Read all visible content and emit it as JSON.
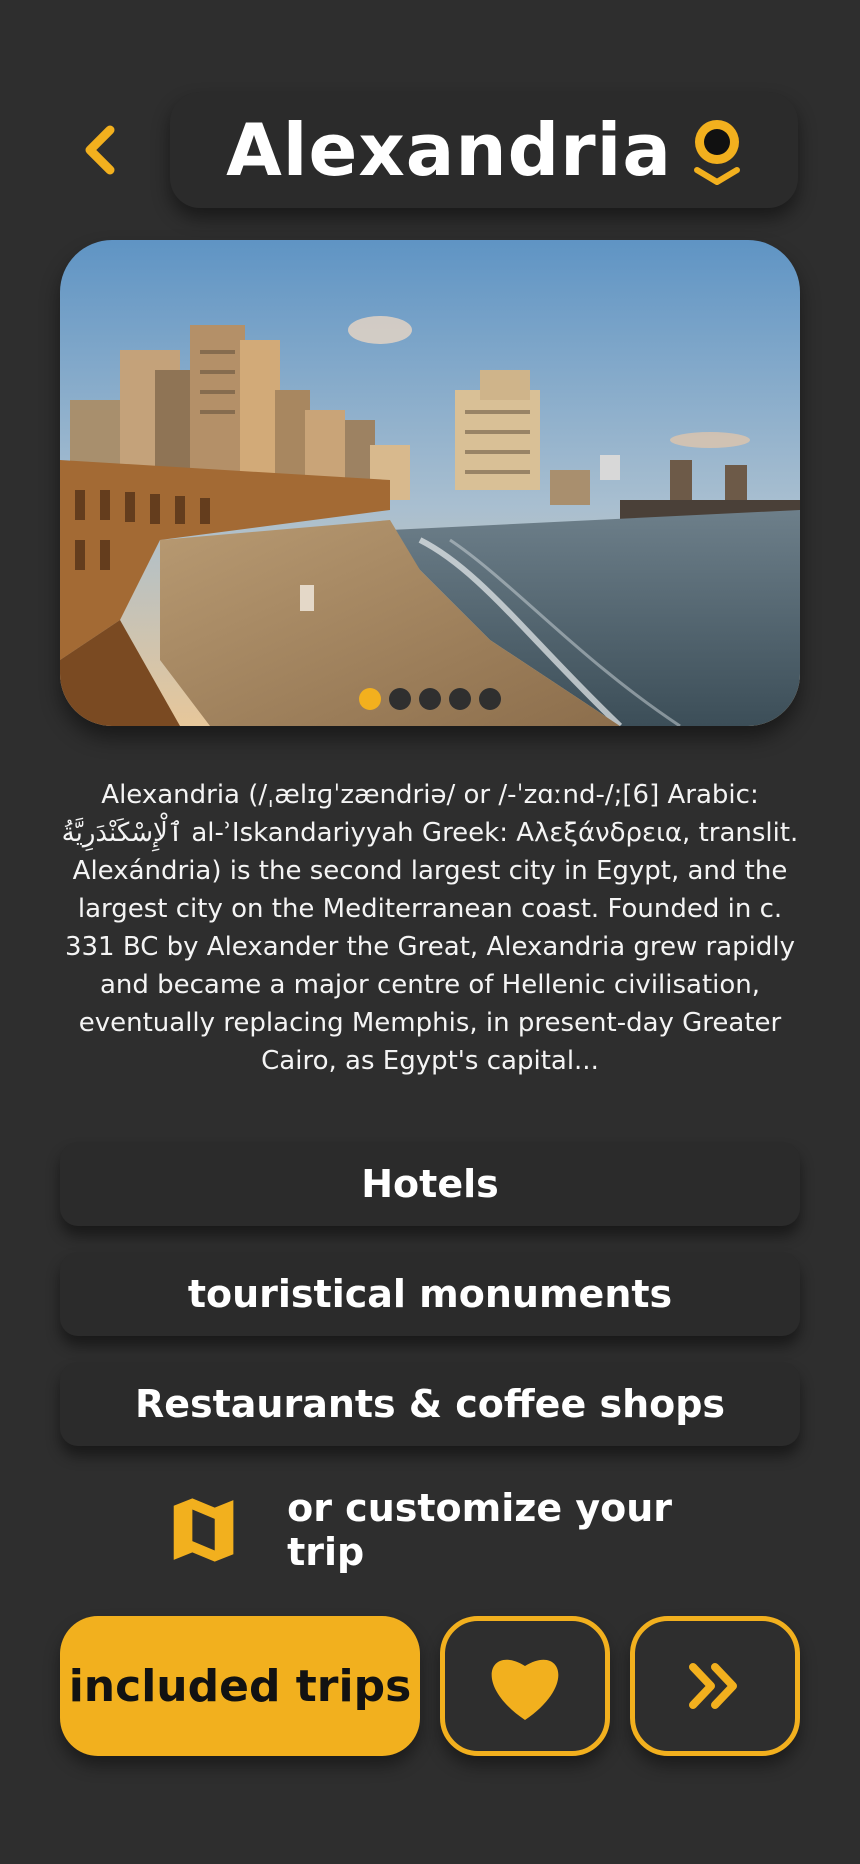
{
  "header": {
    "title": "Alexandria",
    "back_icon": "chevron-left-icon",
    "location_icon": "map-pin-icon"
  },
  "gallery": {
    "image_alt": "Alexandria Corniche beach at sunset",
    "dot_count": 5,
    "active_index": 0
  },
  "description": "Alexandria (/ˌælɪɡˈzændriə/ or /-ˈzɑːnd-/;[6] Arabic: ٱلْإِسْكَنْدَرِيَّةُ al-ʾIskandariyyah Greek: Αλεξάνδρεια, translit. Alexándria) is the second largest city in Egypt, and the largest city on the Mediterranean coast. Founded in c. 331 BC by Alexander the Great, Alexandria grew rapidly and became a major centre of Hellenic civilisation, eventually replacing Memphis, in present-day Greater Cairo, as Egypt's capital...",
  "categories": [
    {
      "label": "Hotels"
    },
    {
      "label": "touristical monuments"
    },
    {
      "label": "Restaurants & coffee shops"
    }
  ],
  "customize": {
    "label": "or customize your trip",
    "icon": "map-icon"
  },
  "actions": {
    "included_label": "included trips",
    "favorite_icon": "heart-icon",
    "next_icon": "double-chevron-right-icon"
  },
  "colors": {
    "accent": "#f2b01e",
    "background": "#2e2e2e",
    "card": "#2b2b2b"
  }
}
